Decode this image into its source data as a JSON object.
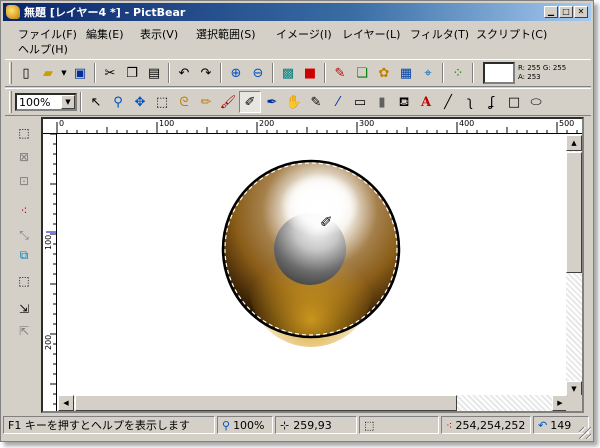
{
  "window": {
    "title": "無題 [レイヤー4 *] - PictBear",
    "minimize_icon": "minimize-icon",
    "maximize_icon": "maximize-icon",
    "close_icon": "close-icon"
  },
  "menu": [
    "ファイル(F)",
    "編集(E)",
    "表示(V)",
    "選択範囲(S)",
    "イメージ(I)",
    "レイヤー(L)",
    "フィルタ(T)",
    "スクリプト(C)",
    "ヘルプ(H)"
  ],
  "toolbar_main": {
    "icons": [
      "new-icon",
      "open-icon",
      "save-icon",
      "cut-icon",
      "copy-icon",
      "paste-icon",
      "undo-icon",
      "redo-icon",
      "zoom-in-icon",
      "zoom-out-icon",
      "image-icon",
      "fill-red-icon",
      "brush-settings-icon",
      "layers-icon",
      "palette-icon",
      "channels-icon",
      "navigator-icon",
      "grid-icon"
    ],
    "color_readout": {
      "r": "R: 255",
      "g": "G: 255",
      "a": "A: 253"
    }
  },
  "toolbar_tools": {
    "zoom_value": "100%",
    "tools": [
      "pointer-icon",
      "magnifier-icon",
      "move-icon",
      "rect-select-icon",
      "lasso-icon",
      "pencil-icon",
      "brush-icon",
      "airbrush-icon",
      "pen-icon",
      "hand-icon",
      "blur-icon",
      "eyedropper-icon",
      "eraser-icon",
      "gradient-icon",
      "bucket-icon",
      "text-icon",
      "line-icon",
      "curve-icon",
      "bezier-icon",
      "rectangle-icon",
      "ellipse-icon"
    ],
    "selected_tool": "airbrush-icon"
  },
  "sidebar": [
    "select-all-icon",
    "deselect-icon",
    "crop-icon",
    "color-mode-icon",
    "transform-icon",
    "merge-icon",
    "selection-icon",
    "layer-up-icon",
    "layer-down-icon"
  ],
  "rulers": {
    "h_labels": [
      "0",
      "100",
      "200",
      "300",
      "400",
      "500"
    ],
    "v_labels": [
      "100",
      "200"
    ]
  },
  "status": {
    "help": "F1 キーを押すとヘルプを表示します",
    "zoom": "100%",
    "coords": "259,93",
    "color": "254,254,252",
    "count": "149"
  }
}
